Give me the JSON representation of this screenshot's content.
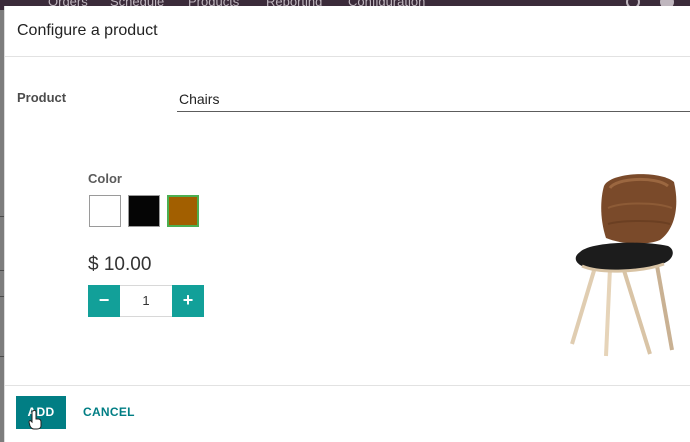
{
  "background": {
    "nav_items": [
      "Orders",
      "Schedule",
      "Products",
      "Reporting",
      "Configuration"
    ]
  },
  "dialog": {
    "title": "Configure a product",
    "product_label": "Product",
    "product_value": "Chairs",
    "color_label": "Color",
    "colors": [
      {
        "name": "white",
        "hex": "#ffffff",
        "selected": false
      },
      {
        "name": "black",
        "hex": "#050505",
        "selected": false
      },
      {
        "name": "brown",
        "hex": "#a25f00",
        "selected": true
      }
    ],
    "price": "$ 10.00",
    "quantity": "1",
    "minus_symbol": "−",
    "plus_symbol": "+",
    "add_label": "ADD",
    "cancel_label": "CANCEL"
  },
  "colors": {
    "accent": "#017e84",
    "stepper": "#12a099",
    "selected_border": "#4caf50"
  }
}
